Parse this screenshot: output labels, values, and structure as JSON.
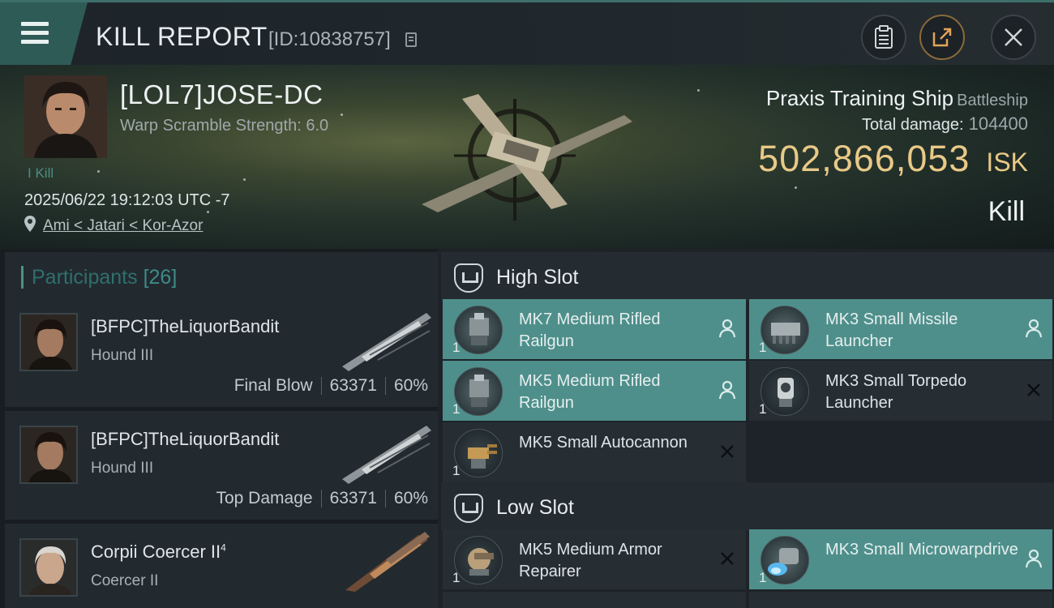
{
  "header": {
    "title": "KILL REPORT",
    "report_id": "[ID:10838757]"
  },
  "victim": {
    "name": "[LOL7]JOSE-DC",
    "scramble": "Warp Scramble Strength: 6.0",
    "kill_tag": "Kill",
    "datetime": "2025/06/22 19:12:03 UTC -7",
    "location": "Ami < Jatari < Kor-Azor",
    "ship_name": "Praxis Training Ship",
    "ship_class": "Battleship",
    "total_damage_label": "Total damage:",
    "total_damage": "104400",
    "isk_value": "502,866,053",
    "isk_unit": "ISK",
    "result": "Kill"
  },
  "participants": {
    "title": "Participants",
    "count": "[26]",
    "rows": [
      {
        "name": "[BFPC]TheLiquorBandit",
        "ship": "Hound III",
        "label": "Final Blow",
        "damage": "63371",
        "percent": "60%"
      },
      {
        "name": "[BFPC]TheLiquorBandit",
        "ship": "Hound III",
        "label": "Top Damage",
        "damage": "63371",
        "percent": "60%"
      },
      {
        "name": "Corpii Coercer II",
        "sup": "4",
        "ship": "Coercer II",
        "label": "",
        "damage": "",
        "percent": ""
      }
    ]
  },
  "slots": {
    "high": {
      "title": "High Slot",
      "modules": [
        {
          "name": "MK7 Medium Rifled Railgun",
          "qty": "1",
          "status": "pilot"
        },
        {
          "name": "MK3 Small Missile Launcher",
          "qty": "1",
          "status": "pilot"
        },
        {
          "name": "MK5 Medium Rifled Railgun",
          "qty": "1",
          "status": "pilot"
        },
        {
          "name": "MK3 Small Torpedo Launcher",
          "qty": "1",
          "status": "destroyed"
        },
        {
          "name": "MK5 Small Autocannon",
          "qty": "1",
          "status": "destroyed"
        }
      ]
    },
    "low": {
      "title": "Low Slot",
      "modules": [
        {
          "name": "MK5 Medium Armor Repairer",
          "qty": "1",
          "status": "destroyed"
        },
        {
          "name": "MK3 Small Microwarpdrive",
          "qty": "1",
          "status": "pilot"
        }
      ]
    }
  },
  "colors": {
    "accent_teal": "#4e8f8b",
    "isk_gold": "#e9c987",
    "panel_dark": "#222a2f"
  }
}
